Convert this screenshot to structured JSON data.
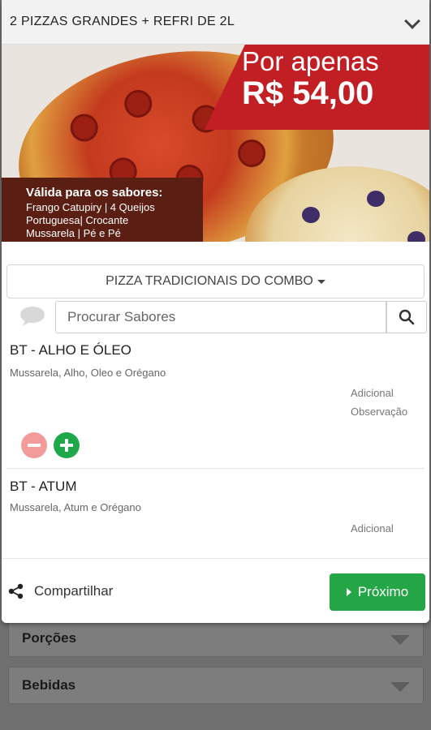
{
  "modal": {
    "title": "2 PIZZAS GRANDES + REFRI DE 2L"
  },
  "banner": {
    "price_line1": "Por apenas",
    "price_line2": "R$ 54,00",
    "flavors_heading": "Válida para os sabores:",
    "flavors_line1": "Frango Catupiry | 4 Queijos",
    "flavors_line2": "Portuguesa| Crocante",
    "flavors_line3": "Mussarela | Pé e Pé"
  },
  "category": {
    "label": "PIZZA TRADICIONAIS DO COMBO"
  },
  "search": {
    "placeholder": "Procurar Sabores"
  },
  "products": [
    {
      "name": "BT - ALHO E ÓLEO",
      "description": "Mussarela, Alho, Oleo e Orégano",
      "extra": "Adicional",
      "note": "Observação"
    },
    {
      "name": "BT - ATUM",
      "description": "Mussarela, Atum e Orégano",
      "extra": "Adicional"
    }
  ],
  "footer": {
    "share_label": "Compartilhar",
    "next_label": "Próximo"
  },
  "background_sections": [
    "Porções",
    "Bebidas"
  ],
  "colors": {
    "accent_green": "#24a546",
    "minus_red": "#f29b9b",
    "banner_red": "#c11f23"
  },
  "icons": [
    "chevron-down-icon",
    "chat-bubble-icon",
    "search-icon",
    "minus-icon",
    "plus-icon",
    "share-icon",
    "play-icon"
  ]
}
